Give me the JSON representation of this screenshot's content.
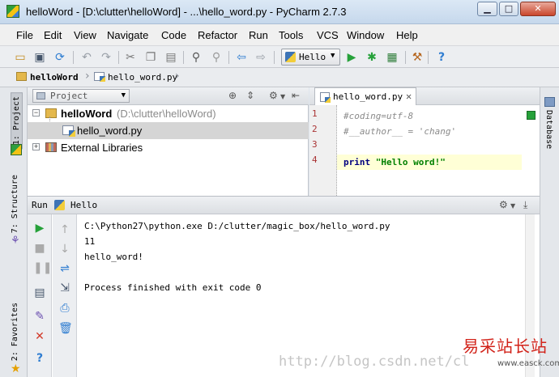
{
  "window": {
    "title": "helloWord - [D:\\clutter\\helloWord] - ...\\hello_word.py - PyCharm 2.7.3",
    "minimize": "▁",
    "maximize": "□",
    "close": "✕"
  },
  "menu": [
    "File",
    "Edit",
    "View",
    "Navigate",
    "Code",
    "Refactor",
    "Run",
    "Tools",
    "VCS",
    "Window",
    "Help"
  ],
  "toolbar": {
    "run_config": "Hello",
    "icons": [
      "open-folder-icon",
      "save-icon",
      "sync-icon",
      "undo-icon",
      "redo-icon",
      "cut-icon",
      "copy-icon",
      "paste-icon",
      "find-icon",
      "replace-icon",
      "back-icon",
      "forward-icon",
      "run-icon",
      "debug-icon",
      "coverage-icon",
      "settings-icon",
      "help-icon"
    ]
  },
  "breadcrumb": [
    "helloWord",
    "hello_word.py"
  ],
  "left_stripe": {
    "project_tab": "1: Project",
    "structure_tab": "7: Structure",
    "favorites_tab": "2: Favorites"
  },
  "right_stripe": {
    "database_tab": "Database"
  },
  "project_panel": {
    "view_selector": "Project",
    "tree": [
      {
        "label": "helloWord",
        "path": "(D:\\clutter\\helloWord)"
      },
      {
        "label": "hello_word.py"
      },
      {
        "label": "External Libraries"
      }
    ]
  },
  "editor": {
    "tab_label": "hello_word.py",
    "tab_close": "✕",
    "line_numbers": [
      "1",
      "2",
      "3",
      "4"
    ],
    "lines": [
      {
        "comment": "#coding=utf-8"
      },
      {
        "comment": "#__author__ = 'chang'"
      },
      {
        "comment": ""
      },
      {
        "keyword": "print",
        "string": "\"Hello word!\""
      }
    ]
  },
  "run_panel": {
    "label": "Run",
    "config": "Hello",
    "console": [
      "C:\\Python27\\python.exe D:/clutter/magic_box/hello_word.py",
      "11",
      "hello_word!",
      "",
      "Process finished with exit code 0"
    ]
  },
  "watermark": {
    "url": "http://blog.csdn.net/cl",
    "site_name": "易采站长站",
    "site_domain": "www.easck.com"
  },
  "colors": {
    "run_green": "#26a13a",
    "line_number_red": "#aa3333",
    "keyword": "#000080",
    "string": "#008000",
    "watermark_red": "#d2231a"
  }
}
